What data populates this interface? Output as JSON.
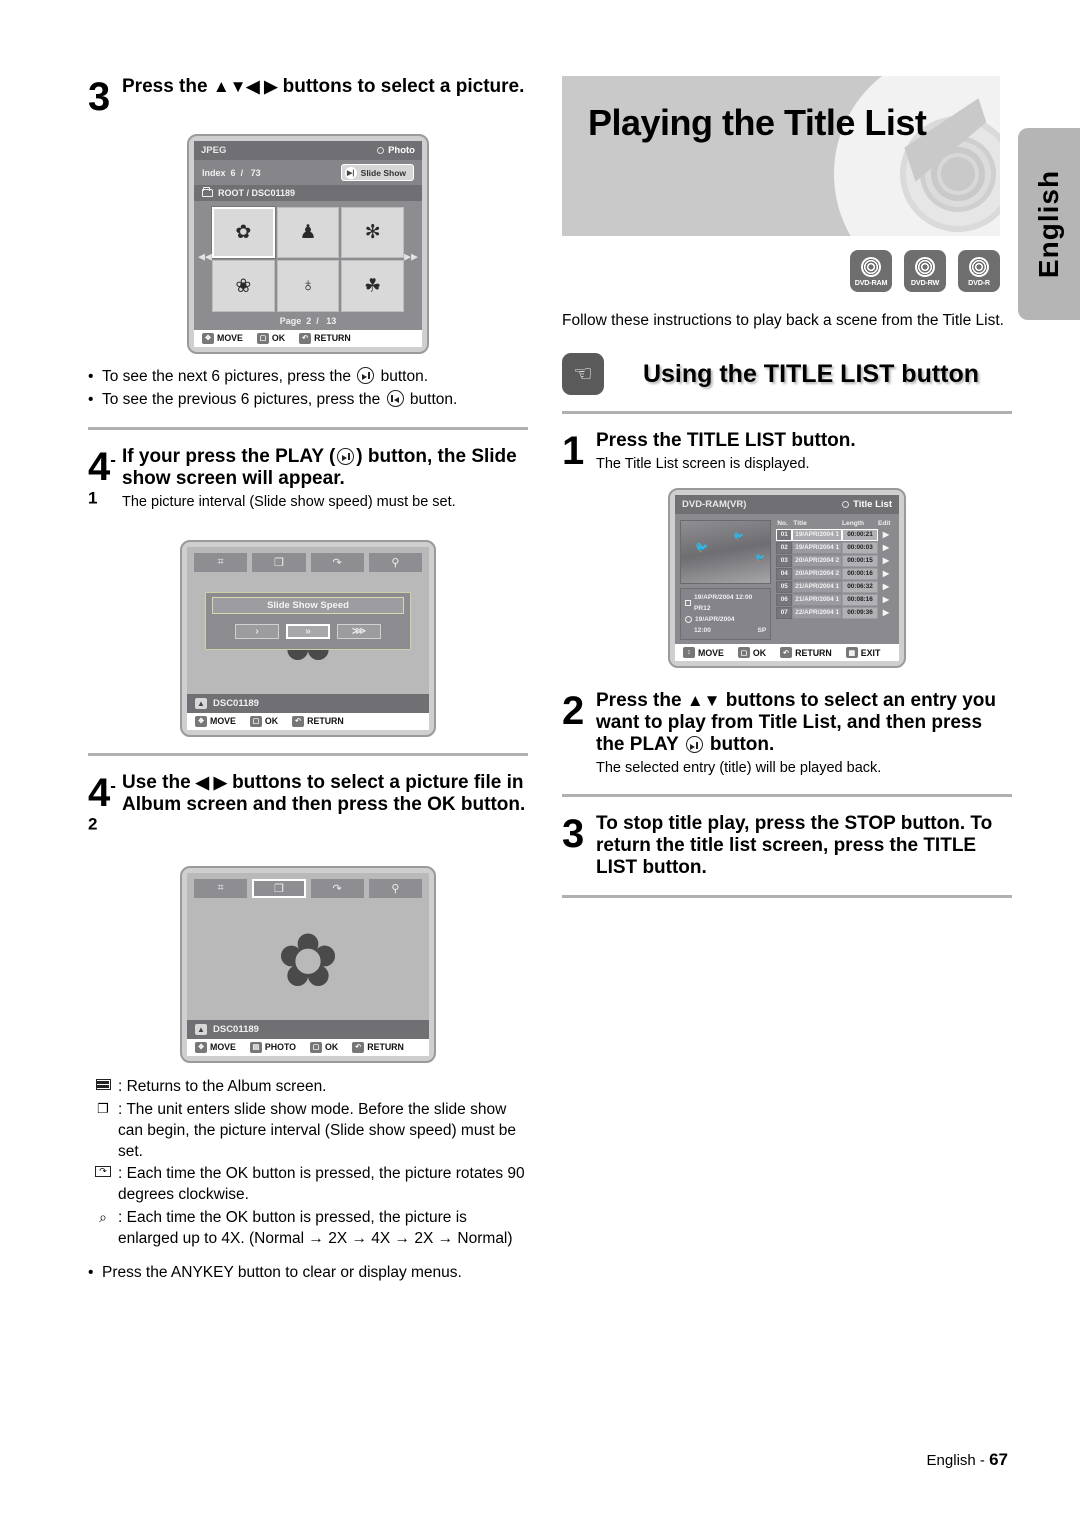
{
  "side_tab": {
    "label": "English"
  },
  "footer": {
    "language": "English - ",
    "page": "67"
  },
  "left_column": {
    "step3": {
      "number": "3",
      "title_pre": "Press the ",
      "arrows": "▲▼◀ ▶",
      "title_post": " buttons to select a picture."
    },
    "jpeg_screen": {
      "format_label": "JPEG",
      "mode_label": "Photo",
      "index_label": "Index",
      "index_current": "6",
      "index_sep": "/",
      "index_total": "73",
      "slideshow_button": "Slide Show",
      "path": "ROOT / DSC01189",
      "thumbnails": [
        {
          "name": "daffodil-thumbnail",
          "glyph": "✿"
        },
        {
          "name": "gnomes-thumbnail",
          "glyph": "♟"
        },
        {
          "name": "sun-thumbnail",
          "glyph": "✻"
        },
        {
          "name": "narcissus-thumbnail",
          "glyph": "❀"
        },
        {
          "name": "girl-thumbnail",
          "glyph": "♁"
        },
        {
          "name": "tree-thumbnail",
          "glyph": "☘"
        }
      ],
      "page_label": "Page",
      "page_current": "2",
      "page_sep": "/",
      "page_total": "13",
      "footer": {
        "move": "MOVE",
        "ok": "OK",
        "return": "RETURN"
      }
    },
    "bullets": [
      {
        "pre": "To see the next 6 pictures, press the ",
        "post": " button.",
        "icon": "next-button-glyph"
      },
      {
        "pre": "To see the previous 6 pictures, press the ",
        "post": " button.",
        "icon": "prev-button-glyph"
      }
    ],
    "step4_1": {
      "number": "4",
      "sup": "-1",
      "title_pre": "If your press the PLAY (",
      "title_post": ") button, the Slide show screen will appear.",
      "sub": "The picture interval (Slide show speed) must be set."
    },
    "slideshow_screen": {
      "toolbar": [
        {
          "name": "album-grid-tool",
          "glyph": "⌗",
          "selected": false
        },
        {
          "name": "slideshow-tool",
          "glyph": "❐",
          "selected": false
        },
        {
          "name": "rotate-tool",
          "glyph": "↷",
          "selected": false
        },
        {
          "name": "zoom-tool",
          "glyph": "⚲",
          "selected": false
        }
      ],
      "dialog_title": "Slide Show Speed",
      "speed_buttons": [
        {
          "name": "speed-slow-button",
          "glyph": "›",
          "selected": false
        },
        {
          "name": "speed-medium-button",
          "glyph": "»",
          "selected": true
        },
        {
          "name": "speed-fast-button",
          "glyph": "⋙",
          "selected": false
        }
      ],
      "file_name": "DSC01189",
      "footer": {
        "move": "MOVE",
        "ok": "OK",
        "return": "RETURN"
      }
    },
    "step4_2": {
      "number": "4",
      "sup": "-2",
      "title_pre": "Use the ",
      "arrows": "◀ ▶",
      "title_post": " buttons to select a picture file in Album screen and then press the OK button."
    },
    "album_screen": {
      "toolbar": [
        {
          "name": "album-grid-tool",
          "glyph": "⌗",
          "selected": false
        },
        {
          "name": "slideshow-tool",
          "glyph": "❐",
          "selected": true
        },
        {
          "name": "rotate-tool",
          "glyph": "↷",
          "selected": false
        },
        {
          "name": "zoom-tool",
          "glyph": "⚲",
          "selected": false
        }
      ],
      "picture_glyph": "✿",
      "file_name": "DSC01189",
      "footer": {
        "move": "MOVE",
        "photo": "PHOTO",
        "ok": "OK",
        "return": "RETURN"
      }
    },
    "legend": [
      {
        "icon": "album-grid-icon",
        "text": ": Returns to the Album screen."
      },
      {
        "icon": "slideshow-icon",
        "text": ": The unit enters slide show mode. Before the slide show can begin, the picture interval (Slide show speed) must be set."
      },
      {
        "icon": "rotate-icon",
        "text": ": Each time the OK button is pressed, the picture rotates 90 degrees clockwise."
      },
      {
        "icon": "zoom-icon",
        "text": ": Each time the OK button is pressed, the picture is enlarged up to 4X. (Normal → 2X → 4X → 2X → Normal)"
      }
    ],
    "anykey_note": "Press the ANYKEY button to clear or display menus."
  },
  "right_column": {
    "banner_title": "Playing the Title List",
    "disc_badges": [
      {
        "name": "dvd-ram-badge",
        "label": "DVD-RAM"
      },
      {
        "name": "dvd-rw-badge",
        "label": "DVD-RW"
      },
      {
        "name": "dvd-r-badge",
        "label": "DVD-R"
      }
    ],
    "intro": "Follow these instructions to play back a scene from the Title List.",
    "section_title": "Using the TITLE LIST button",
    "step1": {
      "number": "1",
      "title": "Press the TITLE LIST button.",
      "sub": "The Title List screen is displayed."
    },
    "title_list_screen": {
      "disc_label": "DVD-RAM(VR)",
      "mode_label": "Title List",
      "info": {
        "line1": "19/APR/2004 12:00 PR12",
        "line2": "19/APR/2004",
        "line3_time": "12:00",
        "line3_mode": "SP"
      },
      "columns": [
        "No.",
        "Title",
        "Length",
        "Edit"
      ],
      "rows": [
        {
          "no": "01",
          "title": "19/APR/2004 1",
          "length": "00:00:21",
          "selected": true
        },
        {
          "no": "02",
          "title": "19/APR/2004 1",
          "length": "00:00:03",
          "selected": false
        },
        {
          "no": "03",
          "title": "20/APR/2004 2",
          "length": "00:00:15",
          "selected": false
        },
        {
          "no": "04",
          "title": "20/APR/2004 2",
          "length": "00:00:16",
          "selected": false
        },
        {
          "no": "05",
          "title": "21/APR/2004 1",
          "length": "00:06:32",
          "selected": false
        },
        {
          "no": "06",
          "title": "21/APR/2004 1",
          "length": "00:08:16",
          "selected": false
        },
        {
          "no": "07",
          "title": "22/APR/2004 1",
          "length": "00:09:36",
          "selected": false
        }
      ],
      "footer": {
        "move": "MOVE",
        "ok": "OK",
        "return": "RETURN",
        "exit": "EXIT"
      }
    },
    "step2": {
      "number": "2",
      "title_pre": "Press the ",
      "arrows": "▲▼",
      "title_mid": " buttons to select an entry you want to play from Title List, and then press the PLAY ",
      "title_post": " button.",
      "sub": "The selected entry (title) will be played back."
    },
    "step3": {
      "number": "3",
      "title": "To stop title play, press the STOP button. To return the title list screen, press the TITLE LIST button."
    }
  }
}
